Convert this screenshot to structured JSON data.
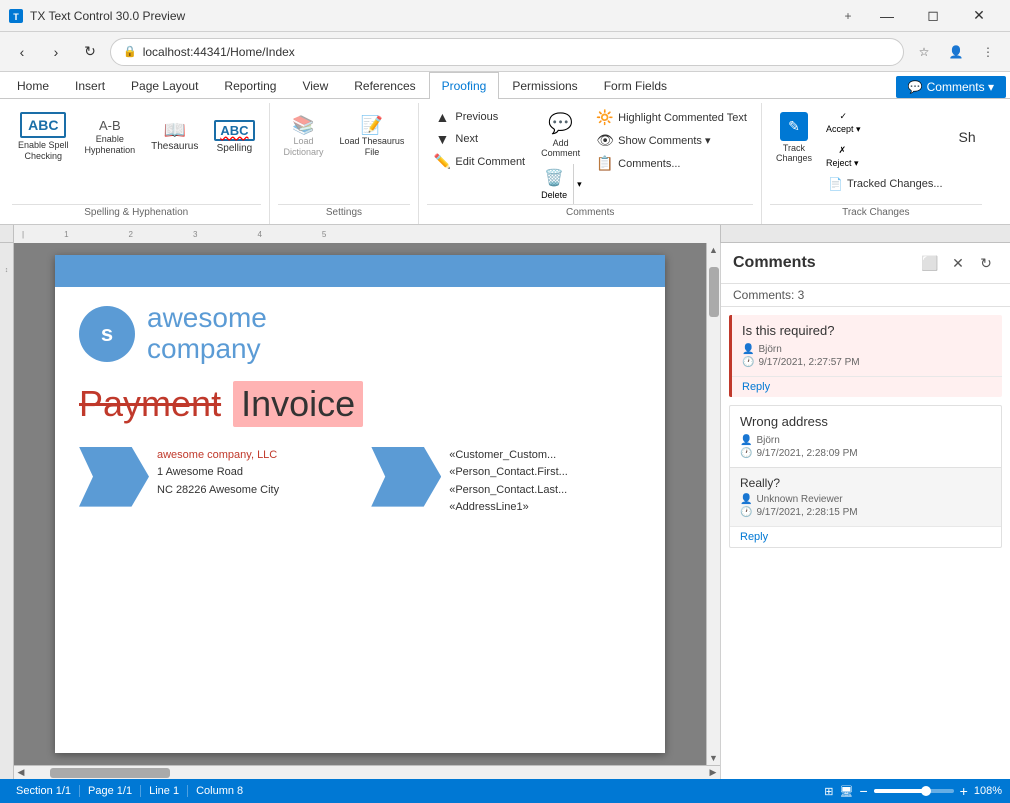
{
  "browser": {
    "title": "TX Text Control 30.0 Preview",
    "url": "localhost:44341/Home/Index",
    "tab_close": "✕",
    "new_tab": "+",
    "nav": {
      "back": "‹",
      "forward": "›",
      "refresh": "↻"
    },
    "icons": {
      "star": "☆",
      "user": "👤",
      "menu": "⋮",
      "shield": "🔒"
    }
  },
  "ribbon": {
    "tabs": [
      "Home",
      "Insert",
      "Page Layout",
      "Reporting",
      "View",
      "References",
      "Proofing",
      "Permissions",
      "Form Fields"
    ],
    "active_tab": "Proofing",
    "comments_btn": "Comments ▾",
    "groups": {
      "spelling": {
        "label": "Spelling & Hyphenation",
        "enable_spell": "Enable Spell\nChecking",
        "enable_hyphen": "Enable\nHyphenation",
        "thesaurus": "Thesaurus",
        "spelling": "Spelling"
      },
      "settings": {
        "label": "Settings",
        "load_dict": "Load\nDictionary",
        "load_thesaurus": "Load Thesaurus\nFile"
      },
      "comments": {
        "label": "Comments",
        "previous": "Previous",
        "next": "Next",
        "add": "Add\nComment",
        "delete": "Delete",
        "edit": "Edit Comment",
        "highlight": "Highlight Commented Text",
        "show": "Show Comments ▾",
        "comments_list": "Comments..."
      },
      "track_changes": {
        "label": "Track Changes",
        "track": "Track\nChanges",
        "accept": "Accept ▾",
        "reject": "Reject ▾",
        "tracked_changes": "Tracked Changes...",
        "show_btn": "Sh..."
      }
    }
  },
  "document": {
    "company_name": "awesome\ncompany",
    "logo_letter": "s",
    "payment_text": "Payment",
    "invoice_text": "Invoice",
    "address_company": "awesome company, LLC",
    "address_line1": "1 Awesome Road",
    "address_line2": "NC 28226 Awesome City",
    "merge_field1": "«Customer_Custom...",
    "merge_field2": "«Person_Contact.First...",
    "merge_field3": "«Person_Contact.Last...",
    "merge_field4": "«AddressLine1»"
  },
  "comments_panel": {
    "title": "Comments",
    "count_label": "Comments: 3",
    "comments": [
      {
        "id": 1,
        "text": "Is this required?",
        "author": "Björn",
        "datetime": "9/17/2021, 2:27:57 PM",
        "highlighted": true,
        "replies": []
      },
      {
        "id": 2,
        "text": "Wrong address",
        "author": "Björn",
        "datetime": "9/17/2021, 2:28:09 PM",
        "highlighted": false,
        "replies": [
          {
            "text": "Really?",
            "author": "Unknown Reviewer",
            "datetime": "9/17/2021, 2:28:15 PM"
          }
        ]
      }
    ],
    "reply_label": "Reply"
  },
  "status_bar": {
    "section": "Section 1/1",
    "page": "Page 1/1",
    "line": "Line 1",
    "column": "Column 8",
    "zoom": "108%",
    "zoom_minus": "−",
    "zoom_plus": "+"
  }
}
